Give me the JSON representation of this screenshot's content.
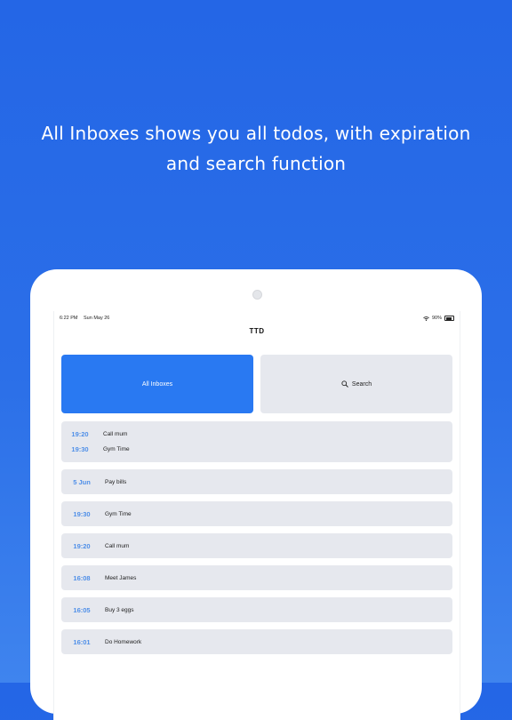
{
  "promo": {
    "line1": "All Inboxes shows you all todos, with expiration",
    "line2": "and search function"
  },
  "status_bar": {
    "time": "6:22 PM",
    "date": "Sun May 26",
    "battery": "90%",
    "wifi_icon": "wifi-icon",
    "battery_icon": "battery-icon"
  },
  "app": {
    "title": "TTD"
  },
  "tiles": {
    "all_inboxes": "All Inboxes",
    "search": "Search",
    "search_icon": "search-icon"
  },
  "colors": {
    "background": "#2466e6",
    "accent": "#2979f2",
    "card": "#e6e8ee",
    "time_text": "#4f8fe8"
  },
  "todo_groups": [
    {
      "items": [
        {
          "time": "19:20",
          "task": "Call mum"
        },
        {
          "time": "19:30",
          "task": "Gym Time"
        }
      ]
    },
    {
      "items": [
        {
          "time": "5 Jun",
          "task": "Pay bills"
        }
      ]
    },
    {
      "items": [
        {
          "time": "19:30",
          "task": "Gym Time"
        }
      ]
    },
    {
      "items": [
        {
          "time": "19:20",
          "task": "Call mum"
        }
      ]
    },
    {
      "items": [
        {
          "time": "16:08",
          "task": "Meet James"
        }
      ]
    },
    {
      "items": [
        {
          "time": "16:05",
          "task": "Buy 3 eggs"
        }
      ]
    },
    {
      "items": [
        {
          "time": "16:01",
          "task": "Do Homework"
        }
      ]
    }
  ]
}
